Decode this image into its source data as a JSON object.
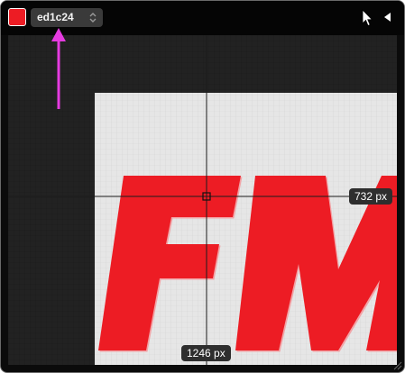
{
  "picker": {
    "color_hex": "ed1c24",
    "swatch_color": "#ed1c24"
  },
  "toolbar": {
    "cursor_icon": "arrow-pointer-icon",
    "collapse_icon": "triangle-left-icon"
  },
  "magnifier": {
    "height_readout": "732 px",
    "width_readout": "1246 px",
    "magnified_text": "FM",
    "text_color": "#ed1c24",
    "background_color": "#e6e6e6"
  },
  "annotation": {
    "arrow_color": "#e53be0"
  }
}
